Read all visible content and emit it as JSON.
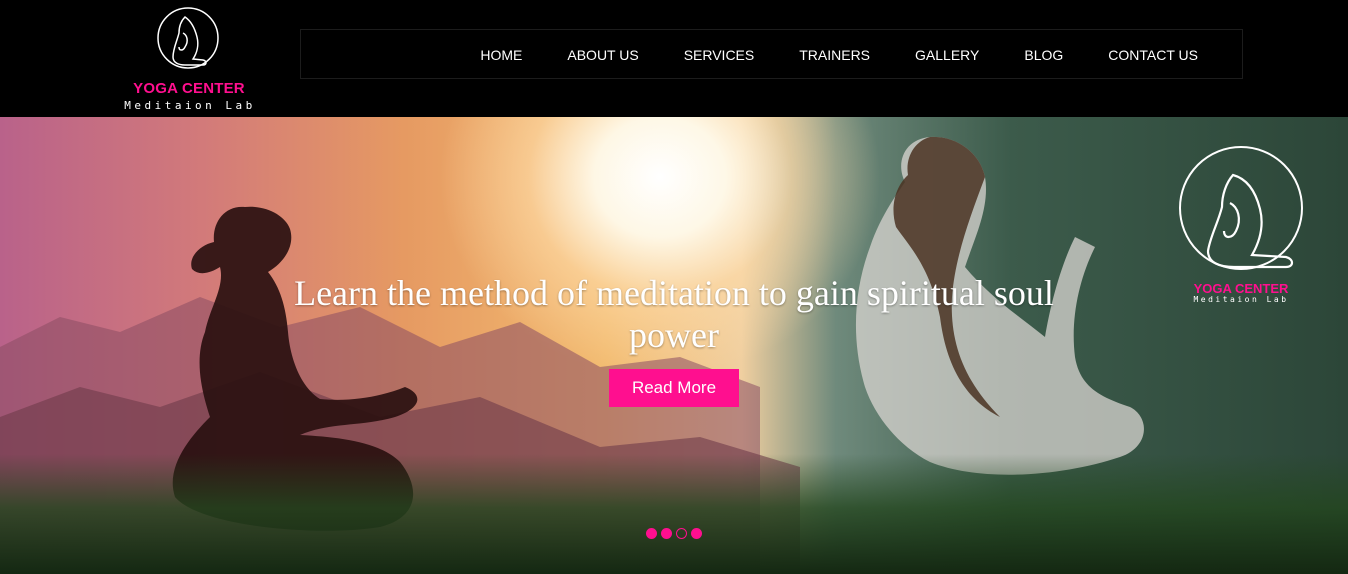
{
  "brand": {
    "name": "YOGA CENTER",
    "tagline": "Meditaion  Lab"
  },
  "nav": {
    "items": [
      "HOME",
      "ABOUT US",
      "SERVICES",
      "TRAINERS",
      "GALLERY",
      "BLOG",
      "CONTACT US"
    ]
  },
  "hero": {
    "title": "Learn the method of meditation to gain spiritual soul power",
    "button": "Read More",
    "slides": 4,
    "active_slide": 3
  },
  "colors": {
    "accent": "#ff0f8f",
    "header_bg": "#000000"
  }
}
